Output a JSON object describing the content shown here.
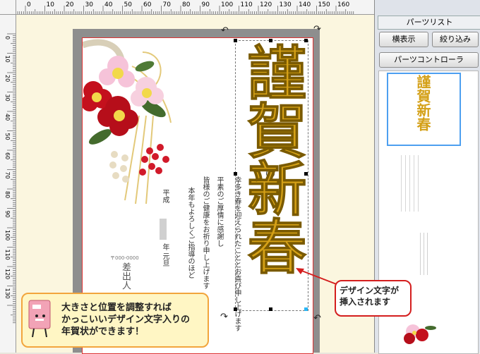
{
  "ruler": {
    "top_labels": [
      "20",
      "10",
      "0",
      "10",
      "20",
      "30",
      "40",
      "50",
      "60",
      "70",
      "80",
      "90",
      "100",
      "110",
      "120",
      "130",
      "140",
      "150",
      "160"
    ],
    "left_labels": [
      "0",
      "10",
      "20",
      "30",
      "40",
      "50",
      "60",
      "70",
      "80",
      "90",
      "100",
      "110",
      "120",
      "130"
    ]
  },
  "side_panel": {
    "title": "パーツリスト",
    "view_button": "横表示",
    "filter_button": "絞り込み",
    "controller_button": "パーツコントローラ"
  },
  "card": {
    "design_text_chars": "謹賀新春",
    "body_text_lines": [
      "幸多き春を迎えられたこととお喜び申し上げます",
      "平素のご厚情に感謝し",
      "皆様のご健康をお祈り申し上げます",
      "本年もよろしくご指導のほど"
    ],
    "date_era": "平成",
    "date_suffix": "年 元旦",
    "postal": "〒000-0000",
    "sender_label": "差出人"
  },
  "callouts": {
    "tip_line1": "大きさと位置を調整すれば",
    "tip_line2": "かっこいいデザイン文字入りの",
    "tip_line3": "年賀状ができます！",
    "design_line1": "デザイン文字が",
    "design_line2": "挿入されます"
  },
  "colors": {
    "accent_red": "#d41e1e",
    "gold": "#d4a017",
    "selection_blue": "#4d9ff0",
    "callout_orange": "#f2a53d"
  }
}
